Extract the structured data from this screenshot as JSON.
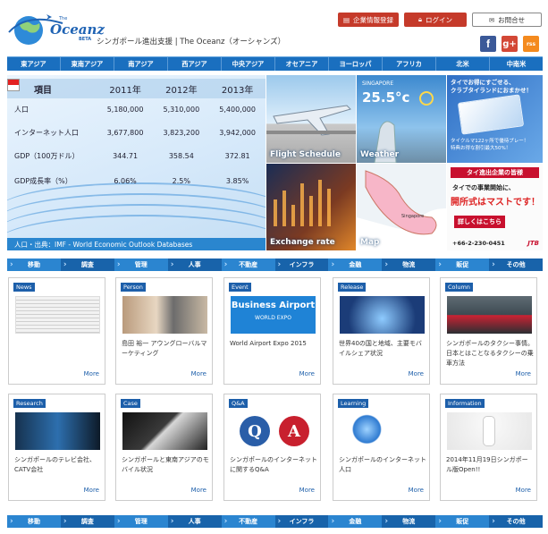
{
  "header": {
    "logo_small": "The",
    "logo_text": "Oceanz",
    "logo_beta": "BETA",
    "tagline": "シンガポール進出支援 | The Oceanz（オーシャンズ）",
    "btn_register": "企業情報登録",
    "btn_login": "ログイン",
    "btn_contact": "お問合せ",
    "social": {
      "facebook": "f",
      "google": "g+",
      "rss": "rss"
    }
  },
  "regions": [
    "東アジア",
    "東南アジア",
    "南アジア",
    "西アジア",
    "中央アジア",
    "オセアニア",
    "ヨーロッパ",
    "アフリカ",
    "北米",
    "中南米"
  ],
  "stats": {
    "header": {
      "label": "項目",
      "y1": "2011年",
      "y2": "2012年",
      "y3": "2013年"
    },
    "rows": [
      {
        "label": "人口",
        "v1": "5,180,000",
        "v2": "5,310,000",
        "v3": "5,400,000"
      },
      {
        "label": "インターネット人口",
        "v1": "3,677,800",
        "v2": "3,823,200",
        "v3": "3,942,000"
      },
      {
        "label": "GDP（100万ドル）",
        "v1": "344.71",
        "v2": "358.54",
        "v3": "372.81"
      },
      {
        "label": "GDP成長率（%）",
        "v1": "6.06%",
        "v2": "2.5%",
        "v3": "3.85%"
      }
    ],
    "source": "人口・出典：IMF - World Economic Outlook Databases"
  },
  "tiles": {
    "flight": "Flight Schedule",
    "weather": "Weather",
    "weather_city": "SINGAPORE",
    "weather_temp": "25.5°c",
    "ad1_line1": "タイでお得にすごせる、",
    "ad1_line2": "クラブタイランドにおまかせ！",
    "ad1_line3": "タイクルマ122ヶ所で優待プレー！",
    "ad1_line4": "特典お得な割引最大50%！",
    "exchange": "Exchange rate",
    "map": "Map",
    "map_city": "Singapore",
    "ad2_banner": "タイ進出企業の皆様",
    "ad2_line1": "タイでの事業開始に、",
    "ad2_line2": "開所式はマストです！",
    "ad2_line3": "詳しくはこちら",
    "ad2_phone": "+66-2-230-0451",
    "ad2_brand": "JTB"
  },
  "categories": [
    "移動",
    "調査",
    "管理",
    "人事",
    "不動産",
    "インフラ",
    "金融",
    "物流",
    "販促",
    "その他"
  ],
  "cards": [
    {
      "tag": "News",
      "text": "",
      "more": "More"
    },
    {
      "tag": "Person",
      "text": "島田 裕一 アウングローバルマーケティング",
      "more": "More"
    },
    {
      "tag": "Event",
      "text": "World Airport Expo 2015",
      "more": "More",
      "img_title": "Business Airport",
      "img_sub": "WORLD EXPO"
    },
    {
      "tag": "Release",
      "text": "世界40の国と地域、主要モバイルシェア状況",
      "more": "More"
    },
    {
      "tag": "Column",
      "text": "シンガポールのタクシー事情。日本とはことなるタクシーの乗車方法",
      "more": "More"
    },
    {
      "tag": "Research",
      "text": "シンガポールのテレビ会社、CATV会社",
      "more": "More"
    },
    {
      "tag": "Case",
      "text": "シンガポールと東南アジアのモバイル状況",
      "more": "More"
    },
    {
      "tag": "Q&A",
      "text": "シンガポールのインターネットに関するQ&A",
      "more": "More",
      "q": "Q",
      "a": "A"
    },
    {
      "tag": "Learning",
      "text": "シンガポールのインターネット人口",
      "more": "More"
    },
    {
      "tag": "Information",
      "text": "2014年11月19日シンガポール版Open!!",
      "more": "More"
    }
  ]
}
